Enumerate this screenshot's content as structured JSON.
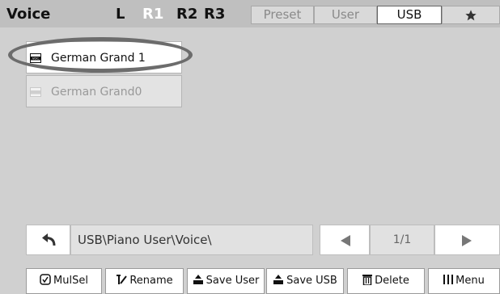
{
  "header": {
    "title": "Voice",
    "parts": [
      "L",
      "R1",
      "R2",
      "R3"
    ],
    "active_part": "R1",
    "tabs": [
      "Preset",
      "User",
      "USB"
    ],
    "active_tab": "USB",
    "favorite_icon": "star-icon"
  },
  "files": [
    {
      "name": "German Grand 1",
      "icon": "voc-file-icon",
      "selected": true
    },
    {
      "name": "German Grand0",
      "icon": "voc-file-icon",
      "selected": false
    }
  ],
  "navigation": {
    "back_icon": "back-arrow-icon",
    "path": "USB\\Piano User\\Voice\\",
    "page": "1/1",
    "prev_icon": "triangle-left-icon",
    "next_icon": "triangle-right-icon"
  },
  "toolbar": {
    "mulsel": "MulSel",
    "rename": "Rename",
    "save_user": "Save User",
    "save_usb": "Save USB",
    "delete": "Delete",
    "menu": "Menu"
  },
  "colors": {
    "background": "#d0d0d0",
    "topbar": "#bfbfbf",
    "active_part": "#ffffff",
    "highlight_oval": "#6c6c6c"
  }
}
